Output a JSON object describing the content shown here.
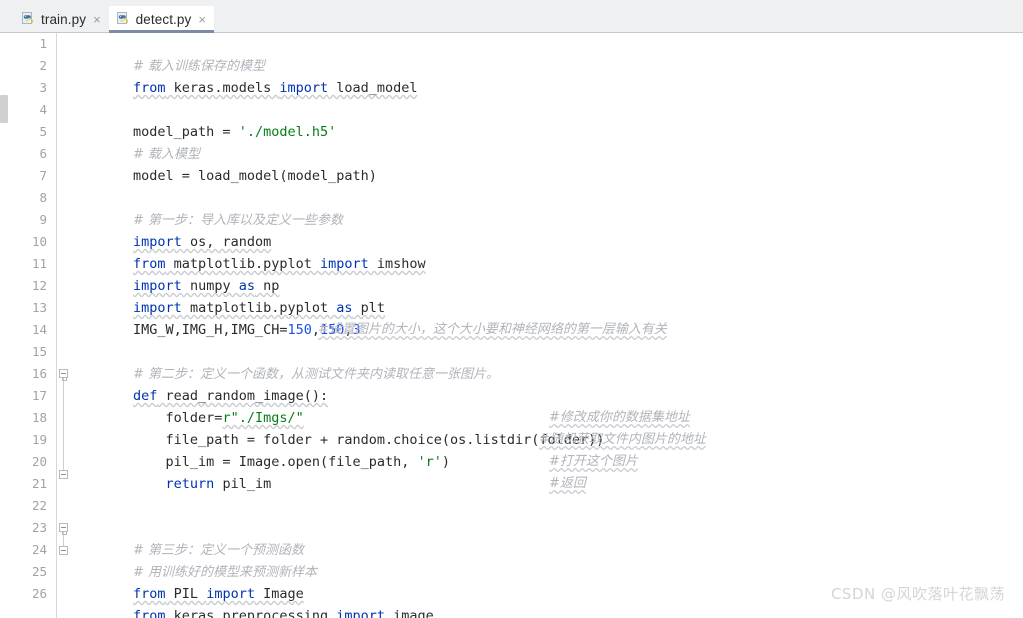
{
  "tabs": [
    {
      "label": "train.py",
      "icon": "python-file-icon",
      "close": "×",
      "active": false
    },
    {
      "label": "detect.py",
      "icon": "python-file-icon",
      "close": "×",
      "active": true
    }
  ],
  "editor": {
    "language": "python",
    "first_line": 1,
    "last_visible_line": 26,
    "line_numbers": [
      "1",
      "2",
      "3",
      "4",
      "5",
      "6",
      "7",
      "8",
      "9",
      "10",
      "11",
      "12",
      "13",
      "14",
      "15",
      "16",
      "17",
      "18",
      "19",
      "20",
      "21",
      "22",
      "23",
      "24",
      "25",
      "26"
    ],
    "lines": [
      {
        "n": "1",
        "text": "# 载入训练保存的模型"
      },
      {
        "n": "2",
        "text": "from keras.models import load_model"
      },
      {
        "n": "3",
        "text": ""
      },
      {
        "n": "4",
        "text": "model_path = './model.h5'"
      },
      {
        "n": "5",
        "text": "# 载入模型"
      },
      {
        "n": "6",
        "text": "model = load_model(model_path)"
      },
      {
        "n": "7",
        "text": ""
      },
      {
        "n": "8",
        "text": "# 第一步：导入库以及定义一些参数"
      },
      {
        "n": "9",
        "text": "import os, random"
      },
      {
        "n": "10",
        "text": "from matplotlib.pyplot import imshow"
      },
      {
        "n": "11",
        "text": "import numpy as np"
      },
      {
        "n": "12",
        "text": "import matplotlib.pyplot as plt"
      },
      {
        "n": "13",
        "text": "IMG_W,IMG_H,IMG_CH=150,150,3    #设置图片的大小，这个大小要和神经网络的第一层输入有关"
      },
      {
        "n": "14",
        "text": ""
      },
      {
        "n": "15",
        "text": "# 第二步：定义一个函数，从测试文件夹内读取任意一张图片。"
      },
      {
        "n": "16",
        "text": "def read_random_image():"
      },
      {
        "n": "17",
        "text": "    folder=r\"./Imgs/\"                             #修改成你的数据集地址"
      },
      {
        "n": "18",
        "text": "    file_path = folder + random.choice(os.listdir(folder)) #随机获取文件内图片的地址"
      },
      {
        "n": "19",
        "text": "    pil_im = Image.open(file_path, 'r')           #打开这个图片"
      },
      {
        "n": "20",
        "text": "    return pil_im                                 #返回"
      },
      {
        "n": "21",
        "text": ""
      },
      {
        "n": "22",
        "text": ""
      },
      {
        "n": "23",
        "text": "# 第三步：定义一个预测函数"
      },
      {
        "n": "24",
        "text": "# 用训练好的模型来预测新样本"
      },
      {
        "n": "25",
        "text": "from PIL import Image"
      },
      {
        "n": "26",
        "text": "from keras.preprocessing import image"
      }
    ],
    "tokens": {
      "l1_comment": "# 载入训练保存的模型",
      "l2_kw_from": "from",
      "l2_mod": " keras.models ",
      "l2_kw_import": "import",
      "l2_name": " load_model",
      "l4_var": "model_path = ",
      "l4_str": "'./model.h5'",
      "l5_comment": "# 载入模型",
      "l6_text": "model = load_model(model_path)",
      "l8_comment": "# 第一步：导入库以及定义一些参数",
      "l9_kw": "import",
      "l9_rest": " os, random",
      "l10_kw1": "from",
      "l10_mid": " matplotlib.pyplot ",
      "l10_kw2": "import",
      "l10_rest": " imshow",
      "l11_kw1": "import",
      "l11_mid": " numpy ",
      "l11_kw2": "as",
      "l11_rest": " np",
      "l12_kw1": "import",
      "l12_mid": " matplotlib.pyplot ",
      "l12_kw2": "as",
      "l12_rest": " plt",
      "l13_names": "IMG_W,IMG_H,IMG_CH=",
      "l13_n1": "150",
      "l13_c1": ",",
      "l13_n2": "150",
      "l13_c2": ",",
      "l13_n3": "3",
      "l13_comment": "#设置图片的大小，这个大小要和神经网络的第一层输入有关",
      "l15_comment": "# 第二步：定义一个函数，从测试文件夹内读取任意一张图片。",
      "l16_kw": "def",
      "l16_name": " read_random_image():",
      "l17_var": "    folder=",
      "l17_str": "r\"./Imgs/\"",
      "l17_comment": "#修改成你的数据集地址",
      "l18_text": "    file_path = folder + random.choice(os.listdir(folder))",
      "l18_comment": "#随机获取文件内图片的地址",
      "l19_text": "    pil_im = Image.open(file_path, ",
      "l19_str": "'r'",
      "l19_tail": ")",
      "l19_comment": "#打开这个图片",
      "l20_kw": "    return",
      "l20_rest": " pil_im",
      "l20_comment": "#返回",
      "l23_comment": "# 第三步：定义一个预测函数",
      "l24_comment": "# 用训练好的模型来预测新样本",
      "l25_kw1": "from",
      "l25_mid": " PIL ",
      "l25_kw2": "import",
      "l25_rest": " Image",
      "l26_kw1": "from",
      "l26_mid": " keras.preprocessing ",
      "l26_kw2": "import",
      "l26_rest": " image"
    }
  },
  "watermark": {
    "text": "CSDN @风吹落叶花飘荡"
  },
  "colors": {
    "keyword": "#0033b3",
    "string": "#067d17",
    "number": "#1750eb",
    "comment": "#b0b4ba",
    "text": "#2b2b2b",
    "line_number": "#a0a3a7",
    "tab_underline": "#7a8ba6",
    "chrome": "#eff0f1",
    "editor_bg": "#ffffff",
    "watermark": "#d3d5d8"
  }
}
